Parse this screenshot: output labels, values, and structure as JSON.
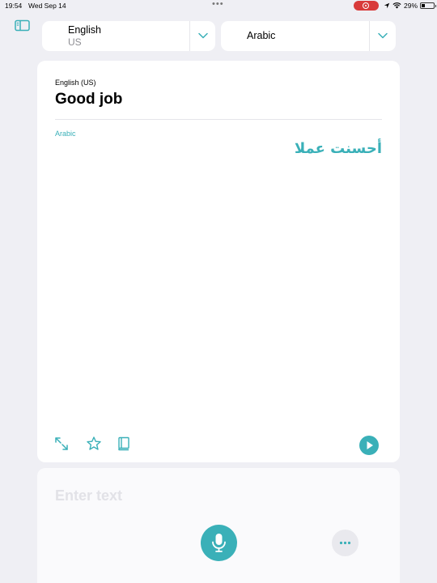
{
  "status_bar": {
    "time": "19:54",
    "date": "Wed Sep 14",
    "battery_percent": "29%",
    "battery_level": 0.29
  },
  "language_bar": {
    "source": {
      "name": "English",
      "region": "US"
    },
    "target": {
      "name": "Arabic"
    }
  },
  "translation_card": {
    "source_label": "English (US)",
    "source_text": "Good job",
    "target_label": "Arabic",
    "target_text": "أحسنت عملا"
  },
  "input_card": {
    "placeholder": "Enter text"
  },
  "colors": {
    "accent": "#3ab0b8",
    "background": "#efeff4",
    "recording_indicator": "#d83a3a"
  },
  "icons": {
    "sidebar": "sidebar-toggle-icon",
    "expand": "expand-arrows-icon",
    "favorite": "star-icon",
    "dictionary": "book-icon",
    "play": "play-icon",
    "mic": "microphone-icon",
    "more": "ellipsis-icon"
  }
}
